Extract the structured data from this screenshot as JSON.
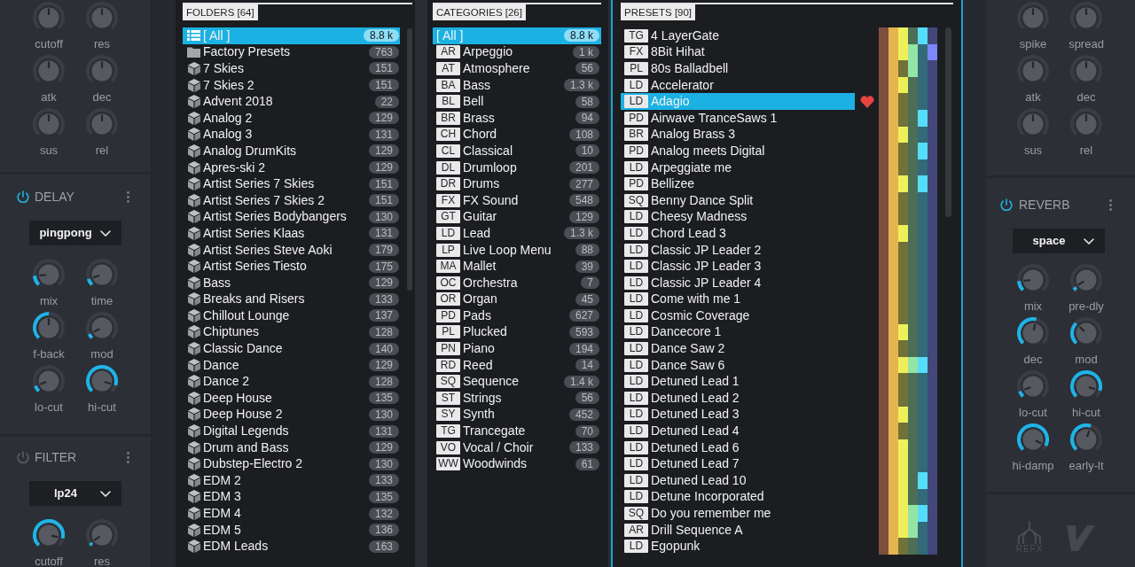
{
  "left_panel": {
    "sections": [
      {
        "knobs": [
          {
            "label": "cutoff",
            "level": 0.5,
            "kind": "centered"
          },
          {
            "label": "res",
            "level": 0.5,
            "kind": "centered"
          },
          {
            "label": "atk",
            "level": 0.5,
            "kind": "centered"
          },
          {
            "label": "dec",
            "level": 0.5,
            "kind": "centered"
          },
          {
            "label": "sus",
            "level": 0.5,
            "kind": "centered"
          },
          {
            "label": "rel",
            "level": 0.5,
            "kind": "centered"
          }
        ]
      },
      {
        "title": "DELAY",
        "on": true,
        "mode": "pingpong",
        "knobs": [
          {
            "label": "mix",
            "level": 0.15,
            "kind": "arc"
          },
          {
            "label": "time",
            "level": 0.1,
            "kind": "arc"
          },
          {
            "label": "f-back",
            "level": 0.5,
            "kind": "arc"
          },
          {
            "label": "mod",
            "level": 0.07,
            "kind": "arc"
          },
          {
            "label": "lo-cut",
            "level": 0.09,
            "kind": "arc"
          },
          {
            "label": "hi-cut",
            "level": 0.9,
            "kind": "arc"
          }
        ]
      },
      {
        "title": "FILTER",
        "on": false,
        "mode": "lp24",
        "knobs": [
          {
            "label": "cutoff",
            "level": 0.88,
            "kind": "arc"
          },
          {
            "label": "res",
            "level": 0.04,
            "kind": "arc"
          }
        ]
      }
    ]
  },
  "browser": {
    "folders": {
      "title": "FOLDERS [64]",
      "items": [
        {
          "kind": "all",
          "label": "[ All ]",
          "count": "8.8 k",
          "selected": true
        },
        {
          "kind": "folder",
          "label": "Factory Presets",
          "count": "763",
          "selected": false
        },
        {
          "kind": "pack",
          "label": "7 Skies",
          "count": "151",
          "selected": false
        },
        {
          "kind": "pack",
          "label": "7 Skies 2",
          "count": "151",
          "selected": false
        },
        {
          "kind": "pack",
          "label": "Advent 2018",
          "count": "22",
          "selected": false
        },
        {
          "kind": "pack",
          "label": "Analog 2",
          "count": "129",
          "selected": false
        },
        {
          "kind": "pack",
          "label": "Analog 3",
          "count": "131",
          "selected": false
        },
        {
          "kind": "pack",
          "label": "Analog DrumKits",
          "count": "129",
          "selected": false
        },
        {
          "kind": "pack",
          "label": "Apres-ski 2",
          "count": "129",
          "selected": false
        },
        {
          "kind": "pack",
          "label": "Artist Series 7 Skies",
          "count": "151",
          "selected": false
        },
        {
          "kind": "pack",
          "label": "Artist Series 7 Skies 2",
          "count": "151",
          "selected": false
        },
        {
          "kind": "pack",
          "label": "Artist Series Bodybangers",
          "count": "130",
          "selected": false
        },
        {
          "kind": "pack",
          "label": "Artist Series Klaas",
          "count": "131",
          "selected": false
        },
        {
          "kind": "pack",
          "label": "Artist Series Steve Aoki",
          "count": "179",
          "selected": false
        },
        {
          "kind": "pack",
          "label": "Artist Series Tiesto",
          "count": "175",
          "selected": false
        },
        {
          "kind": "pack",
          "label": "Bass",
          "count": "129",
          "selected": false
        },
        {
          "kind": "pack",
          "label": "Breaks and Risers",
          "count": "133",
          "selected": false
        },
        {
          "kind": "pack",
          "label": "Chillout Lounge",
          "count": "137",
          "selected": false
        },
        {
          "kind": "pack",
          "label": "Chiptunes",
          "count": "128",
          "selected": false
        },
        {
          "kind": "pack",
          "label": "Classic Dance",
          "count": "140",
          "selected": false
        },
        {
          "kind": "pack",
          "label": "Dance",
          "count": "129",
          "selected": false
        },
        {
          "kind": "pack",
          "label": "Dance 2",
          "count": "128",
          "selected": false
        },
        {
          "kind": "pack",
          "label": "Deep House",
          "count": "135",
          "selected": false
        },
        {
          "kind": "pack",
          "label": "Deep House 2",
          "count": "130",
          "selected": false
        },
        {
          "kind": "pack",
          "label": "Digital Legends",
          "count": "131",
          "selected": false
        },
        {
          "kind": "pack",
          "label": "Drum and Bass",
          "count": "129",
          "selected": false
        },
        {
          "kind": "pack",
          "label": "Dubstep-Electro 2",
          "count": "130",
          "selected": false
        },
        {
          "kind": "pack",
          "label": "EDM 2",
          "count": "133",
          "selected": false
        },
        {
          "kind": "pack",
          "label": "EDM 3",
          "count": "135",
          "selected": false
        },
        {
          "kind": "pack",
          "label": "EDM 4",
          "count": "132",
          "selected": false
        },
        {
          "kind": "pack",
          "label": "EDM 5",
          "count": "136",
          "selected": false
        },
        {
          "kind": "pack",
          "label": "EDM Leads",
          "count": "163",
          "selected": false
        }
      ]
    },
    "categories": {
      "title": "CATEGORIES [26]",
      "items": [
        {
          "kind": "all",
          "label": "[ All ]",
          "count": "8.8 k",
          "selected": true
        },
        {
          "kind": "category",
          "code": "AR",
          "label": "Arpeggio",
          "count": "1 k",
          "selected": false
        },
        {
          "kind": "category",
          "code": "AT",
          "label": "Atmosphere",
          "count": "56",
          "selected": false
        },
        {
          "kind": "category",
          "code": "BA",
          "label": "Bass",
          "count": "1.3 k",
          "selected": false
        },
        {
          "kind": "category",
          "code": "BL",
          "label": "Bell",
          "count": "58",
          "selected": false
        },
        {
          "kind": "category",
          "code": "BR",
          "label": "Brass",
          "count": "94",
          "selected": false
        },
        {
          "kind": "category",
          "code": "CH",
          "label": "Chord",
          "count": "108",
          "selected": false
        },
        {
          "kind": "category",
          "code": "CL",
          "label": "Classical",
          "count": "10",
          "selected": false
        },
        {
          "kind": "category",
          "code": "DL",
          "label": "Drumloop",
          "count": "201",
          "selected": false
        },
        {
          "kind": "category",
          "code": "DR",
          "label": "Drums",
          "count": "277",
          "selected": false
        },
        {
          "kind": "category",
          "code": "FX",
          "label": "FX Sound",
          "count": "548",
          "selected": false
        },
        {
          "kind": "category",
          "code": "GT",
          "label": "Guitar",
          "count": "129",
          "selected": false
        },
        {
          "kind": "category",
          "code": "LD",
          "label": "Lead",
          "count": "1.3 k",
          "selected": false
        },
        {
          "kind": "category",
          "code": "LP",
          "label": "Live Loop Menu",
          "count": "88",
          "selected": false
        },
        {
          "kind": "category",
          "code": "MA",
          "label": "Mallet",
          "count": "39",
          "selected": false
        },
        {
          "kind": "category",
          "code": "OC",
          "label": "Orchestra",
          "count": "7",
          "selected": false
        },
        {
          "kind": "category",
          "code": "OR",
          "label": "Organ",
          "count": "45",
          "selected": false
        },
        {
          "kind": "category",
          "code": "PD",
          "label": "Pads",
          "count": "627",
          "selected": false
        },
        {
          "kind": "category",
          "code": "PL",
          "label": "Plucked",
          "count": "593",
          "selected": false
        },
        {
          "kind": "category",
          "code": "PN",
          "label": "Piano",
          "count": "194",
          "selected": false
        },
        {
          "kind": "category",
          "code": "RD",
          "label": "Reed",
          "count": "14",
          "selected": false
        },
        {
          "kind": "category",
          "code": "SQ",
          "label": "Sequence",
          "count": "1.4 k",
          "selected": false
        },
        {
          "kind": "category",
          "code": "ST",
          "label": "Strings",
          "count": "56",
          "selected": false
        },
        {
          "kind": "category",
          "code": "SY",
          "label": "Synth",
          "count": "452",
          "selected": false
        },
        {
          "kind": "category",
          "code": "TG",
          "label": "Trancegate",
          "count": "70",
          "selected": false
        },
        {
          "kind": "category",
          "code": "VO",
          "label": "Vocal / Choir",
          "count": "133",
          "selected": false
        },
        {
          "kind": "category",
          "code": "WW",
          "label": "Woodwinds",
          "count": "61",
          "selected": false
        }
      ]
    },
    "presets": {
      "title": "PRESETS [90]",
      "tag_columns": [
        {
          "color": "#7d4f3f"
        },
        {
          "color": "#e8b44f"
        },
        {
          "color": "#eef05a"
        },
        {
          "color": "#93e4a5"
        },
        {
          "color": "#55ddfb"
        },
        {
          "color": "#7b87fb"
        }
      ],
      "items": [
        {
          "code": "TG",
          "name": "4 LayerGate",
          "selected": false,
          "favorite": false,
          "tags": [
            true,
            true,
            true,
            false,
            true,
            false
          ]
        },
        {
          "code": "FX",
          "name": "8Bit Hihat",
          "selected": false,
          "favorite": false,
          "tags": [
            true,
            true,
            true,
            true,
            false,
            true
          ]
        },
        {
          "code": "PL",
          "name": "80s Balladbell",
          "selected": false,
          "favorite": false,
          "tags": [
            true,
            true,
            false,
            true,
            false,
            false
          ]
        },
        {
          "code": "LD",
          "name": "Accelerator",
          "selected": false,
          "favorite": false,
          "tags": [
            true,
            true,
            true,
            false,
            false,
            false
          ]
        },
        {
          "code": "LD",
          "name": "Adagio",
          "selected": true,
          "favorite": true,
          "tags": [
            true,
            true,
            false,
            false,
            false,
            false
          ]
        },
        {
          "code": "PD",
          "name": "Airwave TranceSaws 1",
          "selected": false,
          "favorite": false,
          "tags": [
            true,
            true,
            false,
            false,
            true,
            false
          ]
        },
        {
          "code": "BR",
          "name": "Analog Brass 3",
          "selected": false,
          "favorite": false,
          "tags": [
            true,
            true,
            true,
            false,
            false,
            false
          ]
        },
        {
          "code": "PD",
          "name": "Analog meets Digital",
          "selected": false,
          "favorite": false,
          "tags": [
            true,
            true,
            false,
            false,
            true,
            false
          ]
        },
        {
          "code": "LD",
          "name": "Arpeggiate me",
          "selected": false,
          "favorite": false,
          "tags": [
            true,
            true,
            false,
            false,
            false,
            false
          ]
        },
        {
          "code": "PD",
          "name": "Bellizee",
          "selected": false,
          "favorite": false,
          "tags": [
            true,
            true,
            true,
            false,
            true,
            false
          ]
        },
        {
          "code": "SQ",
          "name": "Benny Dance Split",
          "selected": false,
          "favorite": false,
          "tags": [
            true,
            true,
            false,
            false,
            false,
            false
          ]
        },
        {
          "code": "LD",
          "name": "Cheesy Madness",
          "selected": false,
          "favorite": false,
          "tags": [
            true,
            true,
            false,
            false,
            false,
            false
          ]
        },
        {
          "code": "LD",
          "name": "Chord Lead 3",
          "selected": false,
          "favorite": false,
          "tags": [
            true,
            true,
            true,
            false,
            false,
            false
          ]
        },
        {
          "code": "LD",
          "name": "Classic JP Leader 2",
          "selected": false,
          "favorite": false,
          "tags": [
            true,
            true,
            false,
            false,
            false,
            false
          ]
        },
        {
          "code": "LD",
          "name": "Classic JP Leader 3",
          "selected": false,
          "favorite": false,
          "tags": [
            true,
            true,
            false,
            false,
            false,
            false
          ]
        },
        {
          "code": "LD",
          "name": "Classic JP Leader 4",
          "selected": false,
          "favorite": false,
          "tags": [
            true,
            true,
            false,
            false,
            false,
            false
          ]
        },
        {
          "code": "LD",
          "name": "Come with me 1",
          "selected": false,
          "favorite": false,
          "tags": [
            true,
            true,
            false,
            false,
            false,
            false
          ]
        },
        {
          "code": "LD",
          "name": "Cosmic Coverage",
          "selected": false,
          "favorite": false,
          "tags": [
            true,
            true,
            false,
            false,
            false,
            false
          ]
        },
        {
          "code": "LD",
          "name": "Dancecore 1",
          "selected": false,
          "favorite": false,
          "tags": [
            true,
            true,
            true,
            false,
            false,
            false
          ]
        },
        {
          "code": "LD",
          "name": "Dance Saw 2",
          "selected": false,
          "favorite": false,
          "tags": [
            true,
            true,
            false,
            false,
            false,
            false
          ]
        },
        {
          "code": "LD",
          "name": "Dance Saw 6",
          "selected": false,
          "favorite": false,
          "tags": [
            true,
            true,
            true,
            true,
            true,
            false
          ]
        },
        {
          "code": "LD",
          "name": "Detuned Lead 1",
          "selected": false,
          "favorite": false,
          "tags": [
            true,
            true,
            false,
            false,
            false,
            false
          ]
        },
        {
          "code": "LD",
          "name": "Detuned Lead 2",
          "selected": false,
          "favorite": false,
          "tags": [
            true,
            true,
            false,
            false,
            false,
            false
          ]
        },
        {
          "code": "LD",
          "name": "Detuned Lead 3",
          "selected": false,
          "favorite": false,
          "tags": [
            true,
            true,
            true,
            false,
            false,
            false
          ]
        },
        {
          "code": "LD",
          "name": "Detuned Lead 4",
          "selected": false,
          "favorite": false,
          "tags": [
            true,
            true,
            false,
            false,
            false,
            false
          ]
        },
        {
          "code": "LD",
          "name": "Detuned Lead 6",
          "selected": false,
          "favorite": false,
          "tags": [
            true,
            true,
            true,
            false,
            false,
            false
          ]
        },
        {
          "code": "LD",
          "name": "Detuned Lead 7",
          "selected": false,
          "favorite": false,
          "tags": [
            true,
            true,
            true,
            false,
            false,
            false
          ]
        },
        {
          "code": "LD",
          "name": "Detuned Lead 10",
          "selected": false,
          "favorite": false,
          "tags": [
            true,
            true,
            true,
            false,
            true,
            false
          ]
        },
        {
          "code": "LD",
          "name": "Detune Incorporated",
          "selected": false,
          "favorite": false,
          "tags": [
            true,
            true,
            true,
            false,
            false,
            false
          ]
        },
        {
          "code": "SQ",
          "name": "Do you remember me",
          "selected": false,
          "favorite": false,
          "tags": [
            true,
            true,
            true,
            true,
            true,
            false
          ]
        },
        {
          "code": "AR",
          "name": "Drill Sequence A",
          "selected": false,
          "favorite": false,
          "tags": [
            true,
            true,
            true,
            true,
            false,
            false
          ]
        },
        {
          "code": "LD",
          "name": "Egopunk",
          "selected": false,
          "favorite": false,
          "tags": [
            true,
            true,
            false,
            false,
            false,
            false
          ]
        }
      ]
    }
  },
  "right_panel": {
    "sections": [
      {
        "knobs": [
          {
            "label": "spike",
            "level": 0.5,
            "kind": "centered"
          },
          {
            "label": "spread",
            "level": 0.5,
            "kind": "centered"
          },
          {
            "label": "atk",
            "level": 0.5,
            "kind": "centered"
          },
          {
            "label": "dec",
            "level": 0.5,
            "kind": "centered"
          },
          {
            "label": "sus",
            "level": 0.5,
            "kind": "centered"
          },
          {
            "label": "rel",
            "level": 0.5,
            "kind": "centered"
          }
        ]
      },
      {
        "title": "REVERB",
        "on": true,
        "mode": "space",
        "knobs": [
          {
            "label": "mix",
            "level": 0.15,
            "kind": "arc"
          },
          {
            "label": "pre-dly",
            "level": 0.05,
            "kind": "arc"
          },
          {
            "label": "dec",
            "level": 0.55,
            "kind": "arc"
          },
          {
            "label": "mod",
            "level": 0.33,
            "kind": "arc"
          },
          {
            "label": "lo-cut",
            "level": 0.09,
            "kind": "arc"
          },
          {
            "label": "hi-cut",
            "level": 0.9,
            "kind": "arc"
          },
          {
            "label": "hi-damp",
            "level": 0.93,
            "kind": "arc"
          },
          {
            "label": "early-lt",
            "level": 0.57,
            "kind": "arc"
          }
        ]
      }
    ],
    "logo_text": "REFX"
  }
}
